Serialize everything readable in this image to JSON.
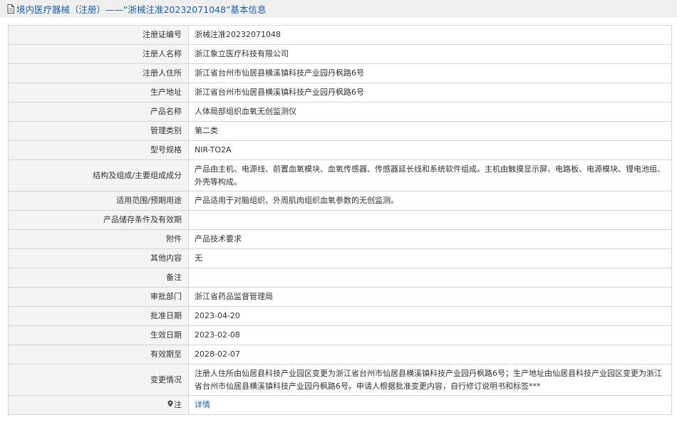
{
  "header": {
    "title": "境内医疗器械（注册）——“浙械注准20232071048”基本信息"
  },
  "rows": [
    {
      "label": "注册证编号",
      "value": "浙械注准20232071048"
    },
    {
      "label": "注册人名称",
      "value": "浙江象立医疗科技有限公司"
    },
    {
      "label": "注册人住所",
      "value": "浙江省台州市仙居县横溪镇科技产业园丹枫路6号"
    },
    {
      "label": "生产地址",
      "value": "浙江省台州市仙居县横溪镇科技产业园丹枫路6号"
    },
    {
      "label": "产品名称",
      "value": "人体局部组织血氧无创监测仪"
    },
    {
      "label": "管理类别",
      "value": "第二类"
    },
    {
      "label": "型号规格",
      "value": "NIR-TO2A"
    },
    {
      "label": "结构及组成/主要组成成分",
      "value": "产品由主机、电源线、前置血氧模块、血氧传感器、传感器延长线和系统软件组成。主机由触摸显示屏、电路板、电源模块、锂电池组、外壳等构成。"
    },
    {
      "label": "适用范围/预期用途",
      "value": "产品适用于对脑组织、外周肌肉组织血氧参数的无创监测。"
    },
    {
      "label": "产品储存条件及有效期",
      "value": ""
    },
    {
      "label": "附件",
      "value": "产品技术要求"
    },
    {
      "label": "其他内容",
      "value": "无"
    },
    {
      "label": "备注",
      "value": ""
    },
    {
      "label": "审批部门",
      "value": "浙江省药品监督管理局"
    },
    {
      "label": "批准日期",
      "value": "2023-04-20"
    },
    {
      "label": "生效日期",
      "value": "2023-02-08"
    },
    {
      "label": "有效期至",
      "value": "2028-02-07"
    },
    {
      "label": "变更情况",
      "value": "注册人住所由仙居县科技产业园区变更为浙江省台州市仙居县横溪镇科技产业园丹枫路6号；生产地址由仙居县科技产业园区变更为浙江省台州市仙居县横溪镇科技产业园丹枫路6号。申请人根据批准变更内容，自行修订说明书和标签***"
    }
  ],
  "note": {
    "label": "注",
    "icon": "pin-icon",
    "link_text": "详情"
  },
  "colors": {
    "header_bg": "#efefef",
    "title_blue": "#1f5fa8",
    "label_bg": "#f4f4f4",
    "border": "#d6d6d6"
  }
}
